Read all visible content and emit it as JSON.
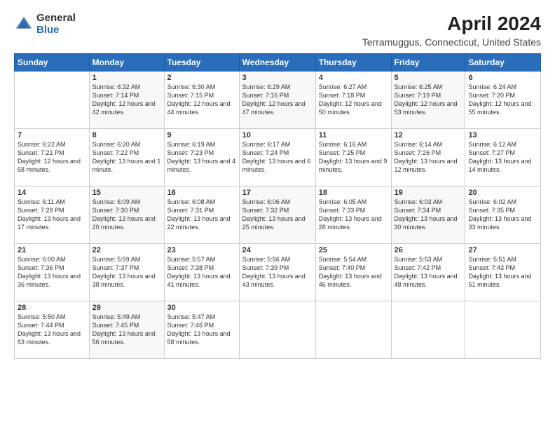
{
  "logo": {
    "general": "General",
    "blue": "Blue"
  },
  "title": "April 2024",
  "subtitle": "Terramuggus, Connecticut, United States",
  "headers": [
    "Sunday",
    "Monday",
    "Tuesday",
    "Wednesday",
    "Thursday",
    "Friday",
    "Saturday"
  ],
  "weeks": [
    [
      {
        "day": "",
        "sunrise": "",
        "sunset": "",
        "daylight": ""
      },
      {
        "day": "1",
        "sunrise": "Sunrise: 6:32 AM",
        "sunset": "Sunset: 7:14 PM",
        "daylight": "Daylight: 12 hours and 42 minutes."
      },
      {
        "day": "2",
        "sunrise": "Sunrise: 6:30 AM",
        "sunset": "Sunset: 7:15 PM",
        "daylight": "Daylight: 12 hours and 44 minutes."
      },
      {
        "day": "3",
        "sunrise": "Sunrise: 6:29 AM",
        "sunset": "Sunset: 7:16 PM",
        "daylight": "Daylight: 12 hours and 47 minutes."
      },
      {
        "day": "4",
        "sunrise": "Sunrise: 6:27 AM",
        "sunset": "Sunset: 7:18 PM",
        "daylight": "Daylight: 12 hours and 50 minutes."
      },
      {
        "day": "5",
        "sunrise": "Sunrise: 6:25 AM",
        "sunset": "Sunset: 7:19 PM",
        "daylight": "Daylight: 12 hours and 53 minutes."
      },
      {
        "day": "6",
        "sunrise": "Sunrise: 6:24 AM",
        "sunset": "Sunset: 7:20 PM",
        "daylight": "Daylight: 12 hours and 55 minutes."
      }
    ],
    [
      {
        "day": "7",
        "sunrise": "Sunrise: 6:22 AM",
        "sunset": "Sunset: 7:21 PM",
        "daylight": "Daylight: 12 hours and 58 minutes."
      },
      {
        "day": "8",
        "sunrise": "Sunrise: 6:20 AM",
        "sunset": "Sunset: 7:22 PM",
        "daylight": "Daylight: 13 hours and 1 minute."
      },
      {
        "day": "9",
        "sunrise": "Sunrise: 6:19 AM",
        "sunset": "Sunset: 7:23 PM",
        "daylight": "Daylight: 13 hours and 4 minutes."
      },
      {
        "day": "10",
        "sunrise": "Sunrise: 6:17 AM",
        "sunset": "Sunset: 7:24 PM",
        "daylight": "Daylight: 13 hours and 6 minutes."
      },
      {
        "day": "11",
        "sunrise": "Sunrise: 6:16 AM",
        "sunset": "Sunset: 7:25 PM",
        "daylight": "Daylight: 13 hours and 9 minutes."
      },
      {
        "day": "12",
        "sunrise": "Sunrise: 6:14 AM",
        "sunset": "Sunset: 7:26 PM",
        "daylight": "Daylight: 13 hours and 12 minutes."
      },
      {
        "day": "13",
        "sunrise": "Sunrise: 6:12 AM",
        "sunset": "Sunset: 7:27 PM",
        "daylight": "Daylight: 13 hours and 14 minutes."
      }
    ],
    [
      {
        "day": "14",
        "sunrise": "Sunrise: 6:11 AM",
        "sunset": "Sunset: 7:28 PM",
        "daylight": "Daylight: 13 hours and 17 minutes."
      },
      {
        "day": "15",
        "sunrise": "Sunrise: 6:09 AM",
        "sunset": "Sunset: 7:30 PM",
        "daylight": "Daylight: 13 hours and 20 minutes."
      },
      {
        "day": "16",
        "sunrise": "Sunrise: 6:08 AM",
        "sunset": "Sunset: 7:31 PM",
        "daylight": "Daylight: 13 hours and 22 minutes."
      },
      {
        "day": "17",
        "sunrise": "Sunrise: 6:06 AM",
        "sunset": "Sunset: 7:32 PM",
        "daylight": "Daylight: 13 hours and 25 minutes."
      },
      {
        "day": "18",
        "sunrise": "Sunrise: 6:05 AM",
        "sunset": "Sunset: 7:33 PM",
        "daylight": "Daylight: 13 hours and 28 minutes."
      },
      {
        "day": "19",
        "sunrise": "Sunrise: 6:03 AM",
        "sunset": "Sunset: 7:34 PM",
        "daylight": "Daylight: 13 hours and 30 minutes."
      },
      {
        "day": "20",
        "sunrise": "Sunrise: 6:02 AM",
        "sunset": "Sunset: 7:35 PM",
        "daylight": "Daylight: 13 hours and 33 minutes."
      }
    ],
    [
      {
        "day": "21",
        "sunrise": "Sunrise: 6:00 AM",
        "sunset": "Sunset: 7:36 PM",
        "daylight": "Daylight: 13 hours and 36 minutes."
      },
      {
        "day": "22",
        "sunrise": "Sunrise: 5:59 AM",
        "sunset": "Sunset: 7:37 PM",
        "daylight": "Daylight: 13 hours and 38 minutes."
      },
      {
        "day": "23",
        "sunrise": "Sunrise: 5:57 AM",
        "sunset": "Sunset: 7:38 PM",
        "daylight": "Daylight: 13 hours and 41 minutes."
      },
      {
        "day": "24",
        "sunrise": "Sunrise: 5:56 AM",
        "sunset": "Sunset: 7:39 PM",
        "daylight": "Daylight: 13 hours and 43 minutes."
      },
      {
        "day": "25",
        "sunrise": "Sunrise: 5:54 AM",
        "sunset": "Sunset: 7:40 PM",
        "daylight": "Daylight: 13 hours and 46 minutes."
      },
      {
        "day": "26",
        "sunrise": "Sunrise: 5:53 AM",
        "sunset": "Sunset: 7:42 PM",
        "daylight": "Daylight: 13 hours and 48 minutes."
      },
      {
        "day": "27",
        "sunrise": "Sunrise: 5:51 AM",
        "sunset": "Sunset: 7:43 PM",
        "daylight": "Daylight: 13 hours and 51 minutes."
      }
    ],
    [
      {
        "day": "28",
        "sunrise": "Sunrise: 5:50 AM",
        "sunset": "Sunset: 7:44 PM",
        "daylight": "Daylight: 13 hours and 53 minutes."
      },
      {
        "day": "29",
        "sunrise": "Sunrise: 5:49 AM",
        "sunset": "Sunset: 7:45 PM",
        "daylight": "Daylight: 13 hours and 56 minutes."
      },
      {
        "day": "30",
        "sunrise": "Sunrise: 5:47 AM",
        "sunset": "Sunset: 7:46 PM",
        "daylight": "Daylight: 13 hours and 58 minutes."
      },
      {
        "day": "",
        "sunrise": "",
        "sunset": "",
        "daylight": ""
      },
      {
        "day": "",
        "sunrise": "",
        "sunset": "",
        "daylight": ""
      },
      {
        "day": "",
        "sunrise": "",
        "sunset": "",
        "daylight": ""
      },
      {
        "day": "",
        "sunrise": "",
        "sunset": "",
        "daylight": ""
      }
    ]
  ]
}
